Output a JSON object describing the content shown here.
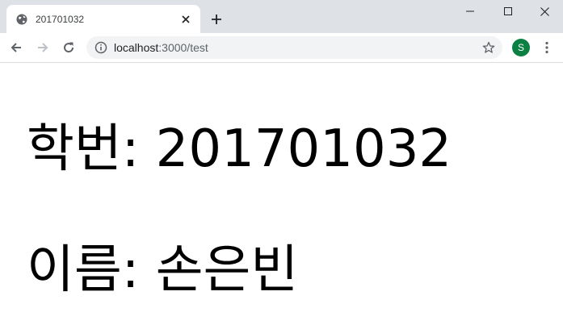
{
  "browser": {
    "tab": {
      "title": "201701032",
      "favicon": "globe-icon"
    },
    "new_tab_icon": "plus-icon",
    "window_controls": [
      "minimize-icon",
      "maximize-icon",
      "close-icon"
    ],
    "nav": {
      "back_icon": "back-arrow-icon",
      "forward_icon": "forward-arrow-icon",
      "reload_icon": "reload-icon"
    },
    "address": {
      "host": "localhost",
      "rest": ":3000/test",
      "info_icon": "info-icon",
      "star_icon": "star-icon"
    },
    "profile_initial": "S",
    "profile_color": "#0b8043",
    "menu_icon": "kebab-menu-icon"
  },
  "page": {
    "student_id_line": "학번: 201701032",
    "name_line": "이름: 손은빈"
  }
}
